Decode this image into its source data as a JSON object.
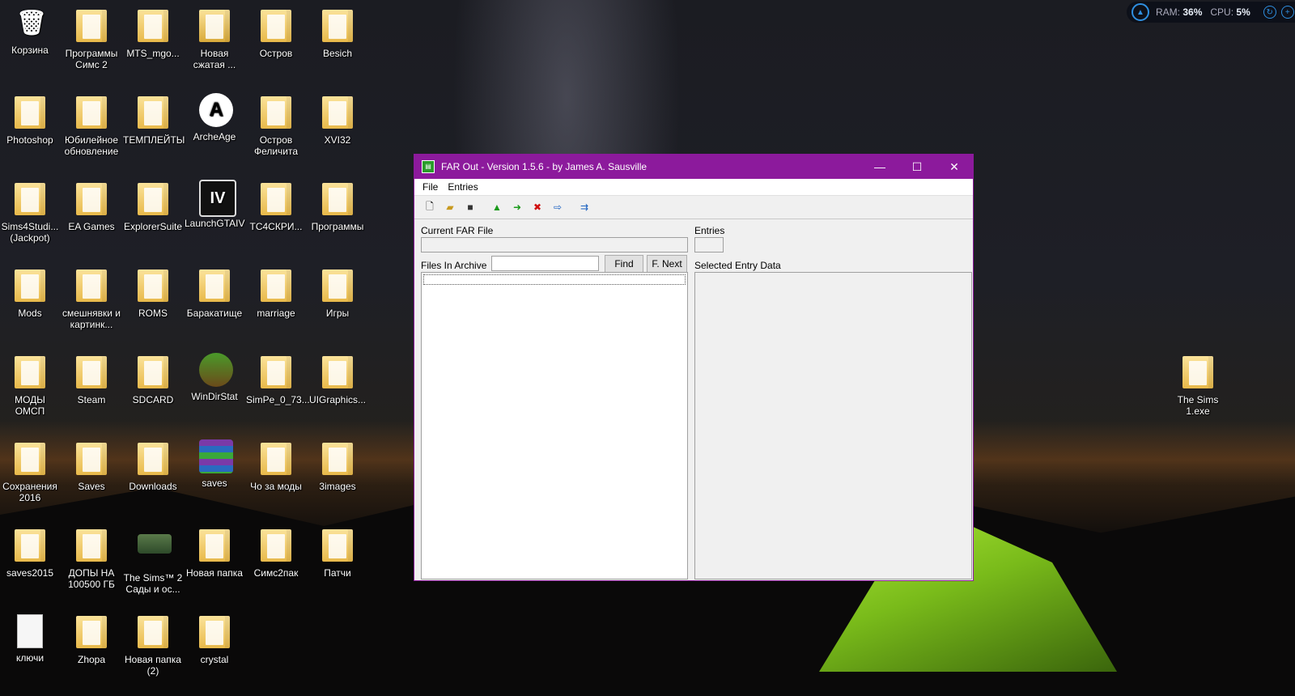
{
  "system_monitor": {
    "ram_label": "RAM:",
    "ram_value": "36%",
    "cpu_label": "CPU:",
    "cpu_value": "5%"
  },
  "desktop_icons": [
    {
      "label": "Корзина",
      "type": "recycle-bin-icon"
    },
    {
      "label": "Программы Симс 2",
      "type": "folder-icon"
    },
    {
      "label": "MTS_mgo...",
      "type": "folder-icon"
    },
    {
      "label": "Новая сжатая ...",
      "type": "zip-folder-icon"
    },
    {
      "label": "Остров",
      "type": "folder-icon"
    },
    {
      "label": "Besich",
      "type": "folder-icon"
    },
    {
      "label": "Photoshop",
      "type": "folder-icon"
    },
    {
      "label": "Юбилейное обновление",
      "type": "folder-icon"
    },
    {
      "label": "ТЕМПЛЕЙТЫ",
      "type": "folder-icon"
    },
    {
      "label": "ArcheAge",
      "type": "archeage-app-icon"
    },
    {
      "label": "Остров Феличита",
      "type": "folder-icon"
    },
    {
      "label": "XVI32",
      "type": "folder-icon"
    },
    {
      "label": "Sims4Studi... (Jackpot)",
      "type": "folder-icon"
    },
    {
      "label": "EA Games",
      "type": "folder-icon"
    },
    {
      "label": "ExplorerSuite",
      "type": "folder-icon"
    },
    {
      "label": "LaunchGTAIV",
      "type": "gta-iv-app-icon"
    },
    {
      "label": "ТС4СКРИ...",
      "type": "folder-icon"
    },
    {
      "label": "Программы",
      "type": "folder-icon"
    },
    {
      "label": "Mods",
      "type": "folder-icon"
    },
    {
      "label": "смешнявки и картинк...",
      "type": "folder-icon"
    },
    {
      "label": "ROMS",
      "type": "folder-icon"
    },
    {
      "label": "Баракатище",
      "type": "folder-icon"
    },
    {
      "label": "marriage",
      "type": "folder-icon"
    },
    {
      "label": "Игры",
      "type": "folder-icon"
    },
    {
      "label": "МОДЫ ОМСП",
      "type": "folder-icon"
    },
    {
      "label": "Steam",
      "type": "folder-icon"
    },
    {
      "label": "SDCARD",
      "type": "folder-icon"
    },
    {
      "label": "WinDirStat",
      "type": "windirstat-app-icon"
    },
    {
      "label": "SimPe_0_73...",
      "type": "folder-icon"
    },
    {
      "label": "UIGraphics...",
      "type": "folder-icon"
    },
    {
      "label": "Сохранения 2016",
      "type": "folder-icon"
    },
    {
      "label": "Saves",
      "type": "folder-icon"
    },
    {
      "label": "Downloads",
      "type": "folder-icon"
    },
    {
      "label": "saves",
      "type": "winrar-archive-icon"
    },
    {
      "label": "Чо за моды",
      "type": "folder-icon"
    },
    {
      "label": "3images",
      "type": "folder-icon"
    },
    {
      "label": "saves2015",
      "type": "folder-icon"
    },
    {
      "label": "ДОПЫ НА 100500 ГБ",
      "type": "folder-icon"
    },
    {
      "label": "The Sims™ 2 Сады и ос...",
      "type": "game-shortcut-icon"
    },
    {
      "label": "Новая папка",
      "type": "folder-icon"
    },
    {
      "label": "Симс2пак",
      "type": "folder-icon"
    },
    {
      "label": "Патчи",
      "type": "folder-icon"
    },
    {
      "label": "ключи",
      "type": "text-file-icon"
    },
    {
      "label": "Zhopa",
      "type": "folder-icon"
    },
    {
      "label": "Новая папка (2)",
      "type": "folder-icon"
    },
    {
      "label": "crystal",
      "type": "folder-icon"
    },
    {
      "label": "The Sims 1.exe",
      "type": "folder-icon"
    }
  ],
  "window": {
    "title": "FAR Out - Version 1.5.6 - by James A. Sausville",
    "menu": [
      "File",
      "Entries"
    ],
    "current_far_label": "Current FAR File",
    "current_far_value": "",
    "entries_label": "Entries",
    "entries_value": "",
    "files_label": "Files In Archive",
    "search_value": "",
    "find_label": "Find",
    "fnext_label": "F. Next",
    "selected_label": "Selected Entry Data"
  }
}
